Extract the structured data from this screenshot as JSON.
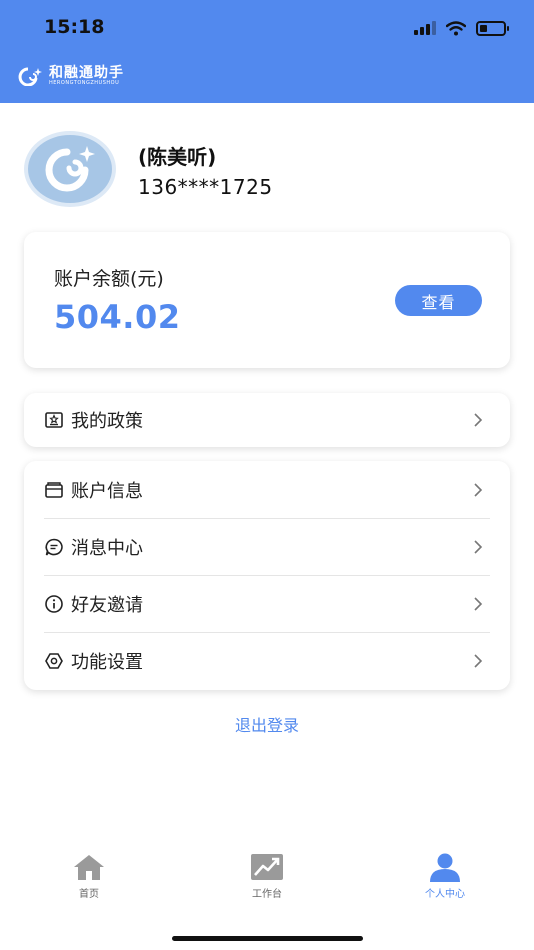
{
  "status_bar": {
    "time": "15:18",
    "battery_level": 0.3
  },
  "header": {
    "logo_title": "和融通助手",
    "logo_subtitle": "HERONGTONGZHUSHOU",
    "bg_color": "#5289ee"
  },
  "profile": {
    "name": "(陈美听)",
    "phone": "136****1725"
  },
  "balance": {
    "label": "账户余额(元)",
    "value": "504.02",
    "button_label": "查看"
  },
  "policy": {
    "label": "我的政策",
    "icon": "policy-icon"
  },
  "menu": {
    "items": [
      {
        "label": "账户信息",
        "icon": "wallet-icon"
      },
      {
        "label": "消息中心",
        "icon": "message-icon"
      },
      {
        "label": "好友邀请",
        "icon": "info-icon"
      },
      {
        "label": "功能设置",
        "icon": "settings-icon"
      }
    ]
  },
  "logout_label": "退出登录",
  "tabbar": {
    "tabs": [
      {
        "label": "首页",
        "icon": "home-icon",
        "active": false
      },
      {
        "label": "工作台",
        "icon": "chart-icon",
        "active": false
      },
      {
        "label": "个人中心",
        "icon": "person-icon",
        "active": true
      }
    ]
  },
  "colors": {
    "accent": "#5289ee",
    "tab_inactive": "#999999"
  }
}
